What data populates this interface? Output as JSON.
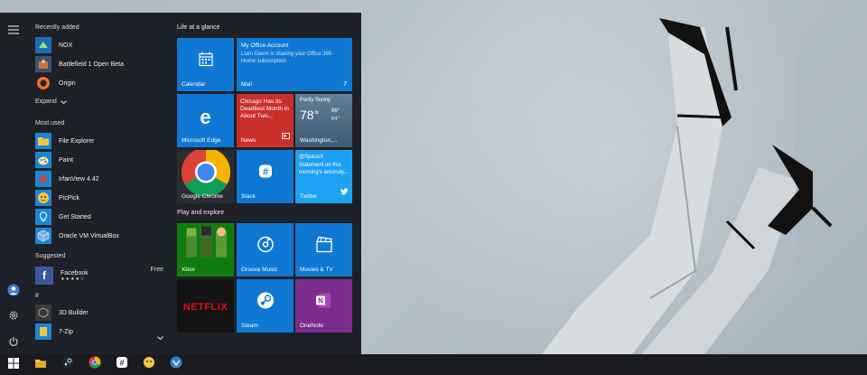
{
  "start_menu": {
    "recently_added": {
      "label": "Recently added",
      "items": [
        {
          "label": "NOX",
          "icon": "nox-icon"
        },
        {
          "label": "Battlefield 1 Open Beta",
          "icon": "battlefield-icon"
        },
        {
          "label": "Origin",
          "icon": "origin-icon"
        }
      ],
      "expand_label": "Expand"
    },
    "most_used": {
      "label": "Most used",
      "items": [
        {
          "label": "File Explorer",
          "icon": "file-explorer-icon"
        },
        {
          "label": "Paint",
          "icon": "paint-icon"
        },
        {
          "label": "IrfanView 4.42",
          "icon": "irfanview-icon"
        },
        {
          "label": "PicPick",
          "icon": "picpick-icon"
        },
        {
          "label": "Get Started",
          "icon": "get-started-icon"
        },
        {
          "label": "Oracle VM VirtualBox",
          "icon": "virtualbox-icon"
        }
      ]
    },
    "suggested": {
      "label": "Suggested",
      "item": {
        "label": "Facebook",
        "tag": "Free",
        "stars": "★★★★☆"
      }
    },
    "hash_section": {
      "label": "#",
      "items": [
        {
          "label": "3D Builder"
        },
        {
          "label": "7-Zip"
        }
      ]
    },
    "tiles": {
      "group1_label": "Life at a glance",
      "group2_label": "Play and explore",
      "calendar": "Calendar",
      "office": {
        "title": "My Office Account",
        "body": "Liam Glenn is sharing your Office 365 Home subscription",
        "app": "Mail",
        "count": "7"
      },
      "edge": "Microsoft Edge",
      "news": {
        "headline": "Chicago Has Its Deadliest Month in About Two...",
        "app": "News"
      },
      "weather": {
        "condition": "Partly Sunny",
        "temp": "78°",
        "high": "86°",
        "low": "64°",
        "location": "Washington,..."
      },
      "chrome": "Google Chrome",
      "slack": "Slack",
      "twitter": {
        "handle": "@SpaceX",
        "body": "Statement on this morning's anomaly...",
        "app": "Twitter"
      },
      "xbox": "Xbox",
      "groove": "Groove Music",
      "movies": "Movies & TV",
      "netflix": "NETFLIX",
      "steam": "Steam",
      "onenote": "OneNote"
    }
  },
  "colors": {
    "tile_blue": "#0f78d4",
    "news_red": "#c9302c",
    "onenote_purple": "#7b2d8e",
    "start_bg": "#1f2128",
    "taskbar_bg": "#1a1b20"
  },
  "taskbar": {
    "items": [
      "windows-icon",
      "file-explorer-icon",
      "steam-icon",
      "chrome-icon",
      "slack-icon",
      "picpick-icon",
      "virtualbox-icon"
    ]
  }
}
